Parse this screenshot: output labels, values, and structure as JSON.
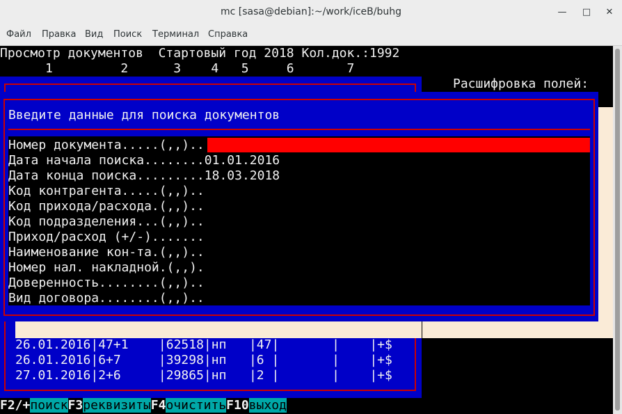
{
  "window": {
    "title": "mc [sasa@debian]:~/work/iceB/buhg",
    "minimize_icon": "minimize-icon",
    "maximize_icon": "maximize-icon",
    "close_icon": "close-icon"
  },
  "menu": {
    "file": "Файл",
    "edit": "Правка",
    "view": "Вид",
    "search": "Поиск",
    "terminal": "Терминал",
    "help": "Справка"
  },
  "header": {
    "line1": "Просмотр документов  Стартовый год 2018 Кол.док.:1992",
    "columns": "      1         2      3    4   5     6       7"
  },
  "legend_title": "Расшифровка полей:",
  "dialog": {
    "title": "Введите данные для поиска документов",
    "fields": [
      {
        "label": "Номер документа.....(,,)..",
        "value": ""
      },
      {
        "label": "Дата начала поиска........",
        "value": "01.01.2016"
      },
      {
        "label": "Дата конца поиска.........",
        "value": "18.03.2018"
      },
      {
        "label": "Код контрагента.....(,,)..",
        "value": ""
      },
      {
        "label": "Код прихода/расхода.(,,)..",
        "value": ""
      },
      {
        "label": "Код подразделения...(,,)..",
        "value": ""
      },
      {
        "label": "Приход/расход (+/-).......",
        "value": ""
      },
      {
        "label": "Наименование кон-та.(,,)..",
        "value": ""
      },
      {
        "label": "Номер нал. накладной.(,,).",
        "value": ""
      },
      {
        "label": "Доверенность........(,,)..",
        "value": ""
      },
      {
        "label": "Вид договора........(,,)..",
        "value": ""
      }
    ]
  },
  "rows": [
    "26.01.2016|47+1    |62518|нп   |47|       |    |+$",
    "26.01.2016|6+7     |39298|нп   |6 |       |    |+$",
    "27.01.2016|2+6     |29865|нп   |2 |       |    |+$"
  ],
  "fkeys": [
    {
      "key": "F2/+",
      "label": "поиск"
    },
    {
      "key": "F3",
      "label": "реквизиты"
    },
    {
      "key": "F4",
      "label": "очистить"
    },
    {
      "key": "F10",
      "label": "выход"
    }
  ],
  "colors": {
    "blue": "#0000c8",
    "red": "#ff0000",
    "cyan": "#00a8a8",
    "beige": "#faebd7"
  }
}
